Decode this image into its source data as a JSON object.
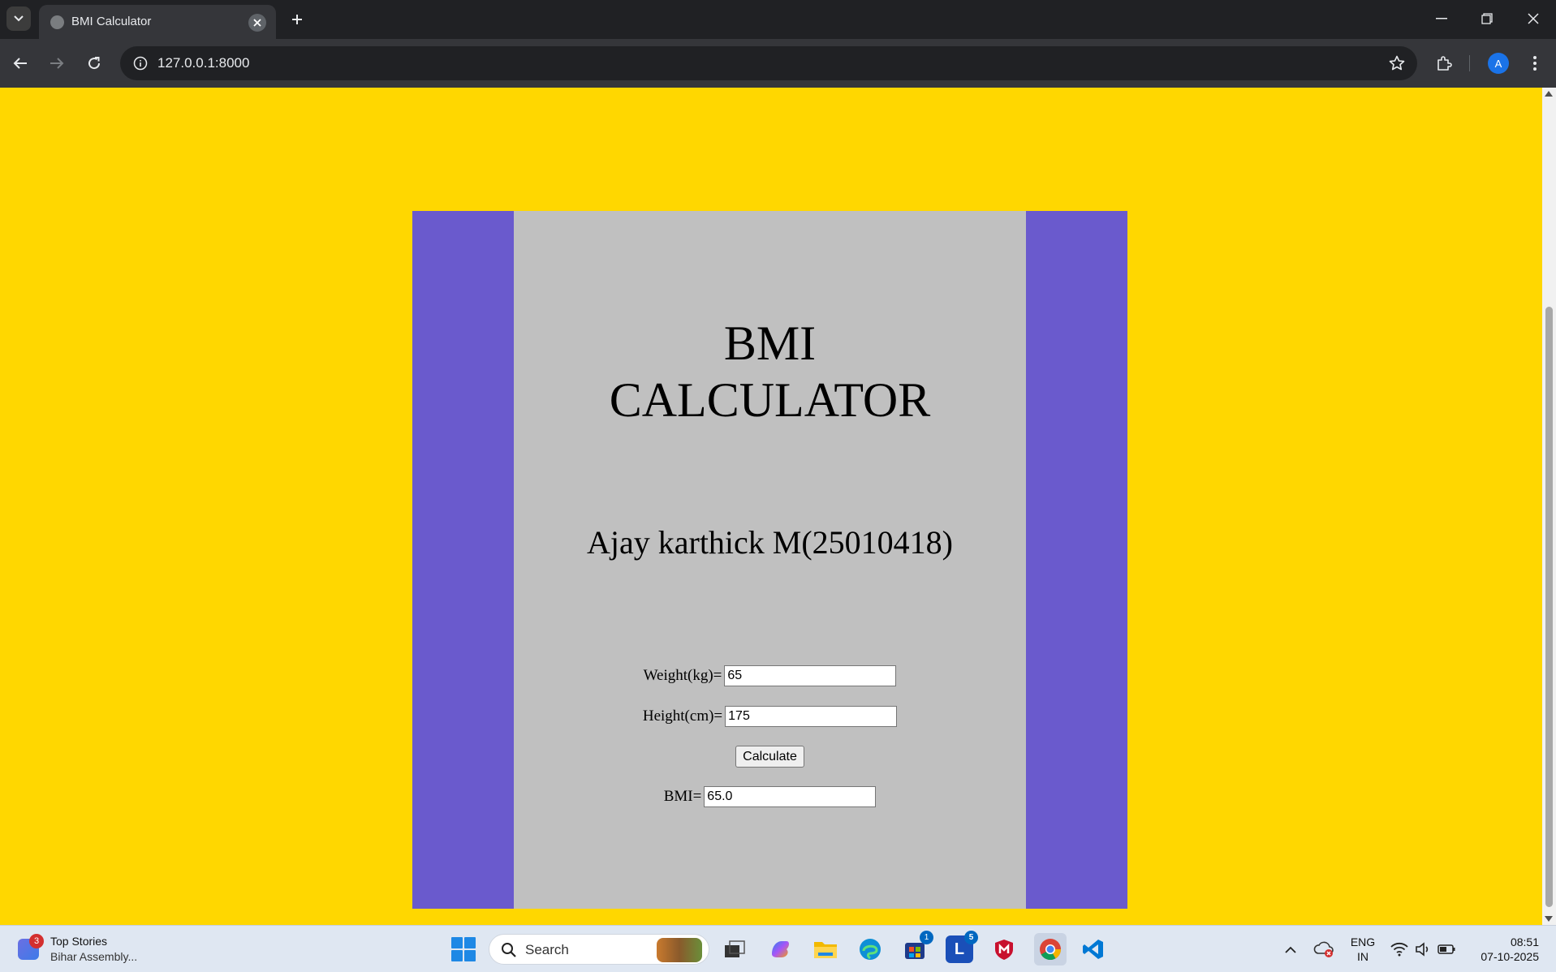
{
  "browser": {
    "tab_title": "BMI Calculator",
    "url": "127.0.0.1:8000",
    "profile_initial": "A"
  },
  "page": {
    "title_line1": "BMI",
    "title_line2": "CALCULATOR",
    "student": "Ajay karthick M(25010418)",
    "weight_label": "Weight(kg)=",
    "weight_value": "65",
    "height_label": "Height(cm)=",
    "height_value": "175",
    "calculate_label": "Calculate",
    "bmi_label": "BMI=",
    "bmi_value": "65.0"
  },
  "colors": {
    "page_background": "#ffd700",
    "container_background": "#6a5acd",
    "card_background": "#c0c0c0"
  },
  "taskbar": {
    "news_badge": "3",
    "news_title": "Top Stories",
    "news_subtitle": "Bihar Assembly...",
    "search_label": "Search",
    "store_badge": "1",
    "l_app_badge": "5",
    "language_line1": "ENG",
    "language_line2": "IN",
    "time": "08:51",
    "date": "07-10-2025"
  }
}
